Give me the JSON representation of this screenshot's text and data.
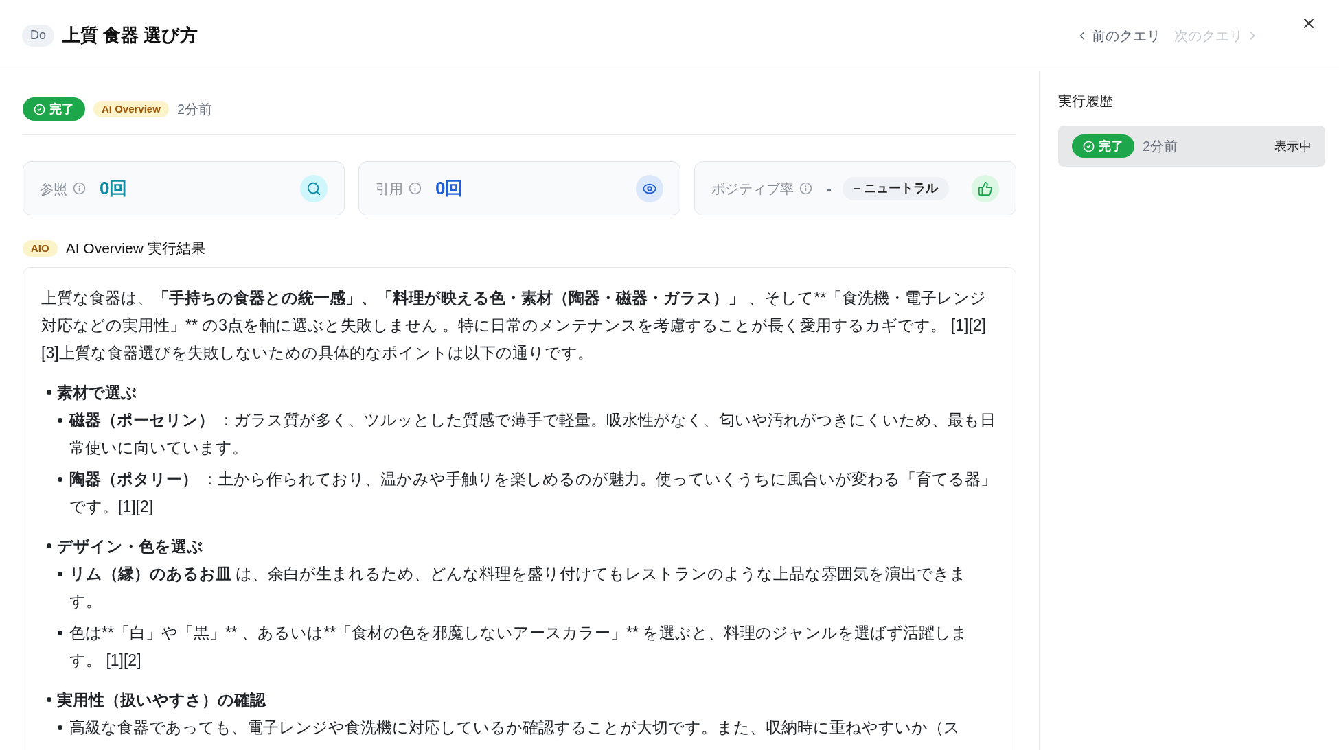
{
  "header": {
    "badge": "Do",
    "title": "上質 食器 選び方",
    "nav": [
      {
        "kind": "prev",
        "label": "前のクエリ",
        "disabled": false
      },
      {
        "kind": "next",
        "label": "次のクエリ",
        "disabled": true
      }
    ]
  },
  "status": {
    "badges": [
      {
        "kind": "status",
        "label": "完了"
      },
      {
        "kind": "tag",
        "label": "AI Overview"
      }
    ],
    "time": "2分前"
  },
  "metrics": [
    {
      "kind": "reference",
      "label": "参照",
      "value": "0回",
      "color": "#0e8ea6"
    },
    {
      "kind": "citation",
      "label": "引用",
      "value": "0回",
      "color": "#1d5fd6"
    },
    {
      "kind": "sentiment",
      "label": "ポジティブ率",
      "value": "-",
      "sentiment": "– ニュートラル",
      "color": "#16a34a"
    }
  ],
  "result": {
    "badge": "AIO",
    "title": "AI Overview 実行結果",
    "intro": [
      {
        "text": "上質な食器は、",
        "bold": false
      },
      {
        "text": "「手持ちの食器との統一感」、「料理が映える色・素材（陶器・磁器・ガラス）」",
        "bold": true
      },
      {
        "text": " 、そして**「食洗機・電子レンジ対応などの実用性」** の3点を軸に選ぶと失敗しません 。特に日常のメンテナンスを考慮することが長く愛用するカギです。 [1][2][3]上質な食器選びを失敗しないための具体的なポイントは以下の通りです。",
        "bold": false
      }
    ],
    "sections": [
      {
        "heading": "素材で選ぶ",
        "items": [
          [
            {
              "text": "磁器（ポーセリン）",
              "bold": true
            },
            {
              "text": " ：ガラス質が多く、ツルッとした質感で薄手で軽量。吸水性がなく、匂いや汚れがつきにくいため、最も日常使いに向いています。",
              "bold": false
            }
          ],
          [
            {
              "text": "陶器（ポタリー）",
              "bold": true
            },
            {
              "text": " ：土から作られており、温かみや手触りを楽しめるのが魅力。使っていくうちに風合いが変わる「育てる器」です。[1][2]",
              "bold": false
            }
          ]
        ]
      },
      {
        "heading": "デザイン・色を選ぶ",
        "items": [
          [
            {
              "text": "リム（縁）のあるお皿",
              "bold": true
            },
            {
              "text": " は、余白が生まれるため、どんな料理を盛り付けてもレストランのような上品な雰囲気を演出できます。",
              "bold": false
            }
          ],
          [
            {
              "text": "色は**「白」や「黒」** 、あるいは**「食材の色を邪魔しないアースカラー」** を選ぶと、料理のジャンルを選ばず活躍します。 [1][2]",
              "bold": false
            }
          ]
        ]
      },
      {
        "heading": "実用性（扱いやすさ）の確認",
        "items": [
          [
            {
              "text": "高級な食器であっても、電子レンジや食洗機に対応しているか確認することが大切です。また、収納時に重ねやすいか（ス",
              "bold": false
            }
          ]
        ]
      }
    ]
  },
  "history": {
    "title": "実行履歴",
    "items": [
      {
        "status": "完了",
        "time": "2分前",
        "note": "表示中",
        "selected": true
      }
    ]
  }
}
